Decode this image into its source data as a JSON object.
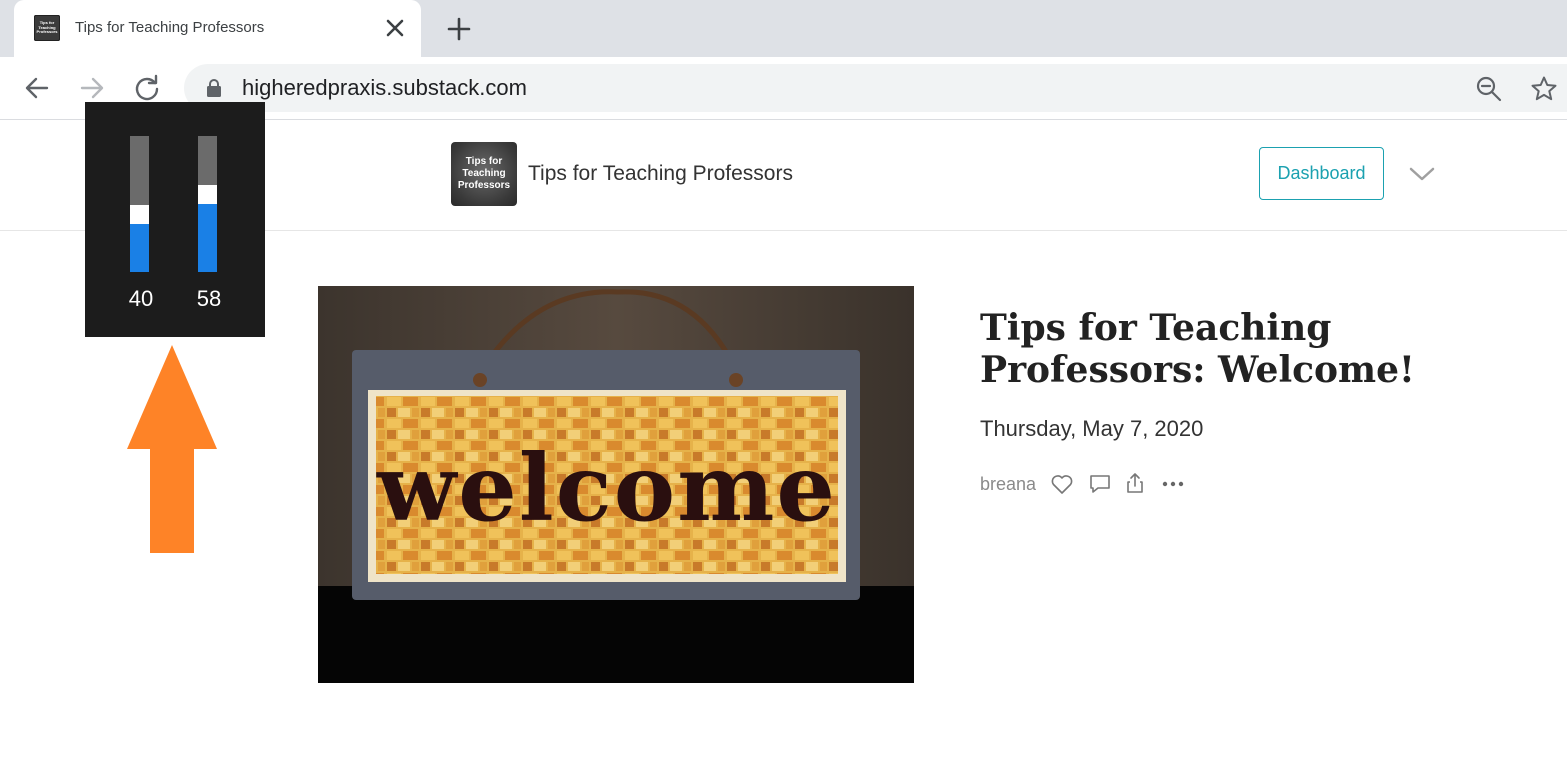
{
  "browser": {
    "tab_title": "Tips for Teaching Professors",
    "tab_favicon_text": "Tips for\nTeaching\nProfessors",
    "url": "higheredpraxis.substack.com"
  },
  "site": {
    "logo_text": "Tips for\nTeaching\nProfessors",
    "name": "Tips for Teaching Professors",
    "dashboard_label": "Dashboard",
    "accent_color": "#1ba1b0"
  },
  "overlay_meter": {
    "bars": [
      {
        "value": "40",
        "level_blue": 0.35,
        "level_white": 0.14
      },
      {
        "value": "58",
        "level_blue": 0.5,
        "level_white": 0.14
      }
    ],
    "blue_color": "#1a80e6",
    "arrow_color": "#fe8327"
  },
  "post": {
    "title": "Tips for Teaching Professors: Welcome!",
    "date": "Thursday, May 7, 2020",
    "author": "breana",
    "hero_image_text": "welcome"
  }
}
